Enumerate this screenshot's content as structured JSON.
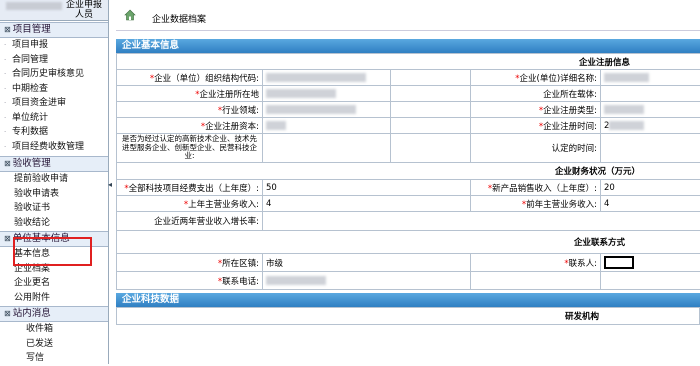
{
  "sidebar": {
    "header": "企业申报人员",
    "sections": [
      {
        "label": "项目管理",
        "items": [
          "项目申报",
          "合同管理",
          "合同历史审核意见",
          "中期检查",
          "项目资金进审",
          "单位统计",
          "专利数据",
          "项目经费收数管理"
        ]
      },
      {
        "label": "验收管理",
        "items": [
          "提前验收申请",
          "验收申请表",
          "验收证书",
          "验收结论"
        ]
      },
      {
        "label": "单位基本信息",
        "items": [
          "基本信息",
          "企业档案",
          "企业更名",
          "公用附件"
        ]
      },
      {
        "label": "站内消息",
        "items": [
          "收件箱",
          "已发送",
          "写信"
        ]
      }
    ],
    "collapse_icon": "◂"
  },
  "topbar": {
    "title": "企业数据档案",
    "icon": "home-icon"
  },
  "band1": "企业基本信息",
  "band2": "企业科技数据",
  "form": {
    "reg_header": "企业注册信息",
    "org_code_label": "企业（单位）组织结构代码:",
    "detail_name_label": "企业(单位)详细名称:",
    "reg_place_label": "企业注册所在地",
    "carrier_label": "企业所在载体:",
    "industry_label": "行业领域:",
    "reg_type_label": "企业注册类型:",
    "reg_capital_label": "企业注册资本:",
    "reg_time_label": "企业注册时间:",
    "reg_time_value": "2",
    "hightech_label": "是否为经过认定的高新技术企业、技术先进型服务企业、创新型企业、民营科技企业:",
    "certified_time_label": "认定的时间:",
    "fin_header": "企业财务状况（万元）",
    "rd_expense_label": "全部科技项目经费支出（上年度）:",
    "rd_expense_value": "50",
    "new_product_label": "新产品销售收入（上年度）:",
    "new_product_value": "20",
    "last_year_revenue_label": "上年主营业务收入:",
    "last_year_revenue_value": "4",
    "prev_year_revenue_label": "前年主营业务收入:",
    "prev_year_revenue_value": "4",
    "growth_label": "企业近两年营业收入增长率:",
    "contact_header": "企业联系方式",
    "district_label": "所在区镇:",
    "district_value": "市级",
    "contact_label": "联系人:",
    "phone_label": "联系电话:",
    "rd_org_header": "研发机构"
  }
}
